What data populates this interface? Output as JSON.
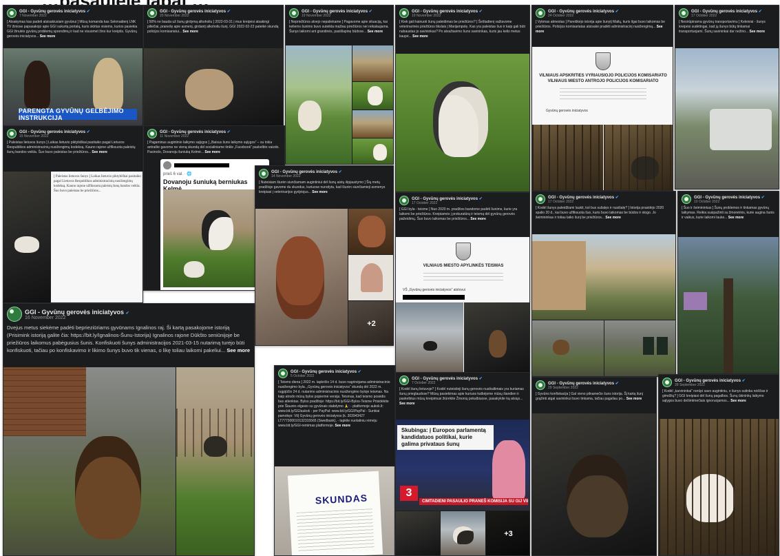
{
  "page": {
    "title": "…pasaulėje labai …"
  },
  "colors": {
    "accent_green": "#2d7b3e",
    "link_blue": "#4a9eff",
    "caption_blue": "#1a56c4",
    "tv_red": "#c91a2a"
  },
  "common": {
    "author": "GGI - Gyvūnų gerovės iniciatyvos",
    "see_more": "See more",
    "verified_icon": "verified-badge-icon"
  },
  "posts": [
    {
      "id": "p1",
      "date": "7 November 2022",
      "text": "[ Atsakymas kas padeti atsisakiusiam gyvūnui ] Mūsų komanda kas Sekmadienį LNK TV žiniose papasakojo apie GGI sukurtą portalą, kuris skirtas visiems, kurios pasiekia GGI žinutės gyvūnų problemų sprendimų ir kad ne visuomet žino kur kreiptis. Gyvūnų gerovės iniciatyvos...",
      "caption": "PARENGTA GYVŪNŲ GELBĖJIMO INSTRUKCIJA"
    },
    {
      "id": "p2",
      "date": "20 November 2022",
      "text": "[ 50% ne bauda už šunų girdymą alkoholiu ] 2022-03-31 į mus kreipėsi atsakingi piliečiai, pranešę apie asmenį, girdantį alkoholiu šunį. GGI 2022-02-22 pateikė skundą policijos komisariatui...",
      "see_more": "See more"
    },
    {
      "id": "p3",
      "date": "19 November 2022",
      "text": "[ Nepriežiūros atvejo nepaliekame ] Pagavome apie situaciją, kai keliems šunims buvo suteikta mažiau priežiūros nei reikalaujama. Šunys laikomi ant grandinės, pasišlapinę būdose...",
      "see_more": "See more"
    },
    {
      "id": "p4",
      "date": "19 November 2022",
      "text": "[ Kiek gali kainuoti šunų paleidimas be priežiūros? ] Šeštadienį važiavome veterinarinės priežiūros tikslais į Marijampolę. Kas yra paleistas šuo ir kaip gali būti nubaustas jo savininkas? Po atvažiavimo šuns savininkas, kuris jau kelis metus kaupė...",
      "see_more": "See more"
    },
    {
      "id": "p5",
      "date": "24 October 2022",
      "text": "[ Vykmas atmestas ] Pareiškėjo istorija apie šunytį Mailų, kuris ilgai buvo laikomas be priežiūros. Policijos komisariatas atsisakė pradėti administracinį nusižengimą...",
      "see_more": "See more",
      "doc_heading": "VILNIAUS APSKRITIES VYRIAUSIOJO POLICIJOS KOMISARIATO VILNIAUS MIESTO ANTROJO POLICIJOS KOMISARIATO",
      "doc_field": "Gyvūnų gerovės iniciatyvos"
    },
    {
      "id": "p6",
      "date": "17 October 2022",
      "text": "[ Nesirūpinama gyvūnų transportavimu ] Keleiviai - šunys kreipėsi sudėtingai, kad jų šunys būtų tinkamai transportuojami. Šunų savininkai dar nežino...",
      "see_more": "See more"
    },
    {
      "id": "p7",
      "date": "15 November 2022",
      "text": "[ Paleistas lietuvos šunys ] Laikas lietuvio piktybiškai pasitaiko pagal Lietuvos Respublikos administracinių nusižengimų kodeksą. Kauno rajone užfiksuota paleistų šunų bandos veikla. Šuo buvo paleistas be priežiūros...",
      "see_more": "See more"
    },
    {
      "id": "p8",
      "date": "11 November 2022",
      "text": "[ Pagaminus augintinio laikymo sąlygos ] „Baisus šuns laikymo sąlygos“ – su tokia antrašte gavome ne vieną skundą dėl socialiniame tinkle „Facebook“ paskelbto vaizdo. Pasirodo, Dovanoju šuniuką Kelmė...",
      "see_more": "See more",
      "fb_card_sub": "prieš 6 val. · 🌐",
      "fb_card_title": "Dovanoju šuniuką berniukas Kelmė"
    },
    {
      "id": "p9",
      "date": "16 November 2022",
      "text": "Dvejus metus siekėme padėti beprieziūriams gyvūnams Ignalinos raj. Ši kartą pasakojome istoriją (Prisimink istoriją galite čia: https://bit.ly/Ignalinos-Šunu-Istorija) Ignalinos rajone Dūkšto seniūnijoje be priežiūros laikomus pabėgusius šunis. Konfiskuoti šunys administracijos 2021-03-15 nutarimą turėjo būti konfiskuoti, tačiau po konfiskavimo ir likimo šunys buvo tik vienas, o likę toliau laikomi pakeliui...",
      "see_more": "See more"
    },
    {
      "id": "p10",
      "date": "14 November 2022",
      "text": "[ Nuteisiam šiurėn siunčiamam augintiniui dėl šunų aistų išpjaustymo ] Šių metų pradžioje gavome du skundus, kuriuose nurodyta, kad šiurėn siunčiamieji asmenys kreipiasi į veterinarijos gydytojus...",
      "see_more": "See more",
      "more_count": "+2"
    },
    {
      "id": "p11",
      "date": "17 October 2022",
      "text": "[ GGI byla - teisme ] Nuo 2020 m. pradžios bandome padėti šunims, kurie yra laikomi be priežiūros. Kreipiamės į prokuratūrą ir teismą dėl gyvūnų gerovės pažeidimų. Šuo buvo laikomas be priežiūros...",
      "see_more": "See more",
      "doc_heading": "VILNIAUS MIESTO APYLINKĖS TEISMAS",
      "doc_field": "VŠ „Gyvūnų gerovės iniciatyvos“ atstovui"
    },
    {
      "id": "p12",
      "date": "17 October 2022",
      "text": "[ Kodėl šunys paleidžiami laukti, kol bus sušalęs ir nusišalę? ] Istorija prasidėjo 2020 spalio 20 d., kai buvo užfiksuota šuo, kuris buvo laikomas be būdos ir stogo. Jo šeimininkas ir toliau laiko šunį be priežiūros...",
      "see_more": "See more"
    },
    {
      "id": "p13",
      "date": "10 October 2022",
      "text": "[ Šuo ir šeimininkas ] Šunų problemos ir tinkamas gyvūnų laikymas. Reikia susipažinti su žmonėmis, kurie augina šunis ir vaikus, kurie laikomi lauke...",
      "see_more": "See more"
    },
    {
      "id": "p14",
      "date": "5 October 2022",
      "text": "[ Teismo diena ] 2022 m. lapkričio 14 d. buvo nagrinėjama administracinio nusižengimo byla. „Gyvūnų gerovės iniciatyvos“ skundą dėl 2022 m. rugpjūčio 24 d. nutarimo administracinio nusižengimo byloje teismas. Na kaip atrodo mūsų bylos popierinė versija. Teismas, kad teismo posėdis bus atlenktas. Bylos pradžioje: https://bit.ly/GGI-Bylos-Teisme Prisidėkite prie Šiaurės elgesio su gyvūnais stabdymo 🙏: - platformoje aukok.lt: www.bit.ly/GGIaukok - per PayPal: www.bit.ly/GGIPayPal - Sunkiai pamokęs: VšĮ Gyvūnų gerovės iniciatyvos Įk. 303943427 LT777300010132315565 (Swedbank), - tapkite nuolatiniu rėmėju www.bit.ly/GGI-remimas platformoje.",
      "see_more": "See more",
      "skundas": "SKUNDAS"
    },
    {
      "id": "p15",
      "date": "7 October 2022",
      "text": "[ Kodėl šunų lietuvoje? ] Kodėl nuteistieji šunų gerovės nusikaltimais yra kuriamas šunų prieglaudose? Mūsų pasiekimas apie kuriuos kalbėjome mūsų šiandien ir paskelbtus mūsų kreipimusi žiūrėkite Žmonių pokalbiuose, pasakykite ką atsiųs...",
      "see_more": "See more",
      "tv_headline": "Skubinga: į Europos parlamentą kandidatuos politikai, kurie galima privataus šunų",
      "tv_ticker": "CIMTADIENI PASAULIO PRANEŠ KOMISIJA SU GIJ VILNIAUS KAM",
      "channel": "3",
      "more_count": "+3"
    },
    {
      "id": "p16",
      "date": "29 September 2022",
      "text": "[ Gyvūno konfiskacija ] Gal vieno pilnamečio šuns istorija. Šį kartą šunį grąžinti atgal savininkui buvo tinkama, tačiau pagaliau po...",
      "see_more": "See more"
    },
    {
      "id": "p17",
      "date": "28 September 2022",
      "text": "[ Kodėl „karvininkai“ nerūpi savo augintiniu, o šunys sutinka nėščias ir gimdžių? ] GGI kreipiasi dėl šunų pagalbos. Šunų ūkininkų laikymo sąlygos buvo dešimtmečiais ignoruojamos...",
      "see_more": "See more"
    }
  ]
}
